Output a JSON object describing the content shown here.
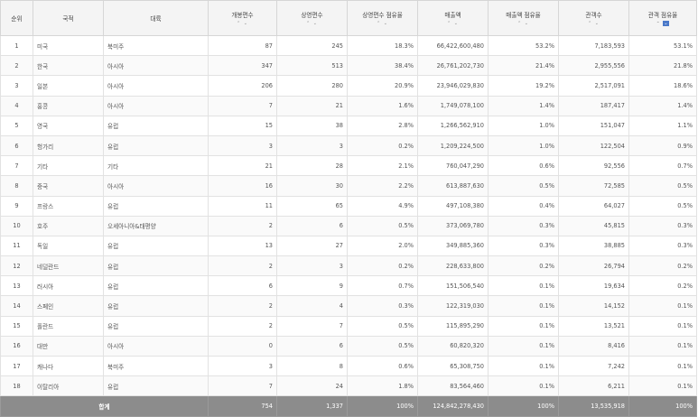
{
  "headers": {
    "rank": "순위",
    "country": "국적",
    "continent": "대륙",
    "releases": "개봉편수",
    "screenings": "상영편수",
    "screening_share": "상영편수 점유율",
    "revenue": "매출액",
    "revenue_share": "매출액 점유율",
    "audience": "관객수",
    "audience_share": "관객 점유율"
  },
  "rows": [
    {
      "rank": "1",
      "country": "미국",
      "continent": "북미주",
      "releases": "87",
      "screenings": "245",
      "screening_share": "18.3%",
      "revenue": "66,422,600,480",
      "revenue_share": "53.2%",
      "audience": "7,183,593",
      "audience_share": "53.1%"
    },
    {
      "rank": "2",
      "country": "한국",
      "continent": "아시아",
      "releases": "347",
      "screenings": "513",
      "screening_share": "38.4%",
      "revenue": "26,761,202,730",
      "revenue_share": "21.4%",
      "audience": "2,955,556",
      "audience_share": "21.8%"
    },
    {
      "rank": "3",
      "country": "일본",
      "continent": "아시아",
      "releases": "206",
      "screenings": "280",
      "screening_share": "20.9%",
      "revenue": "23,946,029,830",
      "revenue_share": "19.2%",
      "audience": "2,517,091",
      "audience_share": "18.6%"
    },
    {
      "rank": "4",
      "country": "홍콩",
      "continent": "아시아",
      "releases": "7",
      "screenings": "21",
      "screening_share": "1.6%",
      "revenue": "1,749,078,100",
      "revenue_share": "1.4%",
      "audience": "187,417",
      "audience_share": "1.4%"
    },
    {
      "rank": "5",
      "country": "영국",
      "continent": "유럽",
      "releases": "15",
      "screenings": "38",
      "screening_share": "2.8%",
      "revenue": "1,266,562,910",
      "revenue_share": "1.0%",
      "audience": "151,047",
      "audience_share": "1.1%"
    },
    {
      "rank": "6",
      "country": "헝가리",
      "continent": "유럽",
      "releases": "3",
      "screenings": "3",
      "screening_share": "0.2%",
      "revenue": "1,209,224,500",
      "revenue_share": "1.0%",
      "audience": "122,504",
      "audience_share": "0.9%"
    },
    {
      "rank": "7",
      "country": "기타",
      "continent": "기타",
      "releases": "21",
      "screenings": "28",
      "screening_share": "2.1%",
      "revenue": "760,047,290",
      "revenue_share": "0.6%",
      "audience": "92,556",
      "audience_share": "0.7%"
    },
    {
      "rank": "8",
      "country": "중국",
      "continent": "아시아",
      "releases": "16",
      "screenings": "30",
      "screening_share": "2.2%",
      "revenue": "613,887,630",
      "revenue_share": "0.5%",
      "audience": "72,585",
      "audience_share": "0.5%"
    },
    {
      "rank": "9",
      "country": "프랑스",
      "continent": "유럽",
      "releases": "11",
      "screenings": "65",
      "screening_share": "4.9%",
      "revenue": "497,108,380",
      "revenue_share": "0.4%",
      "audience": "64,027",
      "audience_share": "0.5%"
    },
    {
      "rank": "10",
      "country": "호주",
      "continent": "오세아니아&태평양",
      "releases": "2",
      "screenings": "6",
      "screening_share": "0.5%",
      "revenue": "373,069,780",
      "revenue_share": "0.3%",
      "audience": "45,815",
      "audience_share": "0.3%"
    },
    {
      "rank": "11",
      "country": "독일",
      "continent": "유럽",
      "releases": "13",
      "screenings": "27",
      "screening_share": "2.0%",
      "revenue": "349,885,360",
      "revenue_share": "0.3%",
      "audience": "38,885",
      "audience_share": "0.3%"
    },
    {
      "rank": "12",
      "country": "네덜란드",
      "continent": "유럽",
      "releases": "2",
      "screenings": "3",
      "screening_share": "0.2%",
      "revenue": "228,633,800",
      "revenue_share": "0.2%",
      "audience": "26,794",
      "audience_share": "0.2%"
    },
    {
      "rank": "13",
      "country": "러시아",
      "continent": "유럽",
      "releases": "6",
      "screenings": "9",
      "screening_share": "0.7%",
      "revenue": "151,506,540",
      "revenue_share": "0.1%",
      "audience": "19,634",
      "audience_share": "0.2%"
    },
    {
      "rank": "14",
      "country": "스페인",
      "continent": "유럽",
      "releases": "2",
      "screenings": "4",
      "screening_share": "0.3%",
      "revenue": "122,319,030",
      "revenue_share": "0.1%",
      "audience": "14,152",
      "audience_share": "0.1%"
    },
    {
      "rank": "15",
      "country": "폴란드",
      "continent": "유럽",
      "releases": "2",
      "screenings": "7",
      "screening_share": "0.5%",
      "revenue": "115,895,290",
      "revenue_share": "0.1%",
      "audience": "13,521",
      "audience_share": "0.1%"
    },
    {
      "rank": "16",
      "country": "대만",
      "continent": "아시아",
      "releases": "0",
      "screenings": "6",
      "screening_share": "0.5%",
      "revenue": "60,820,320",
      "revenue_share": "0.1%",
      "audience": "8,416",
      "audience_share": "0.1%"
    },
    {
      "rank": "17",
      "country": "캐나다",
      "continent": "북미주",
      "releases": "3",
      "screenings": "8",
      "screening_share": "0.6%",
      "revenue": "65,308,750",
      "revenue_share": "0.1%",
      "audience": "7,242",
      "audience_share": "0.1%"
    },
    {
      "rank": "18",
      "country": "이탈리아",
      "continent": "유럽",
      "releases": "7",
      "screenings": "24",
      "screening_share": "1.8%",
      "revenue": "83,564,460",
      "revenue_share": "0.1%",
      "audience": "6,211",
      "audience_share": "0.1%"
    }
  ],
  "totals": {
    "label": "합계",
    "releases": "754",
    "screenings": "1,337",
    "screening_share": "100%",
    "revenue": "124,842,278,430",
    "revenue_share": "100%",
    "audience": "13,535,918",
    "audience_share": "100%"
  },
  "sort": {
    "column": "audience_share",
    "direction": "desc"
  },
  "colors": {
    "header_bg": "#f4f4f4",
    "footer_bg": "#8c8c8c",
    "sort_active": "#4a78c8"
  }
}
